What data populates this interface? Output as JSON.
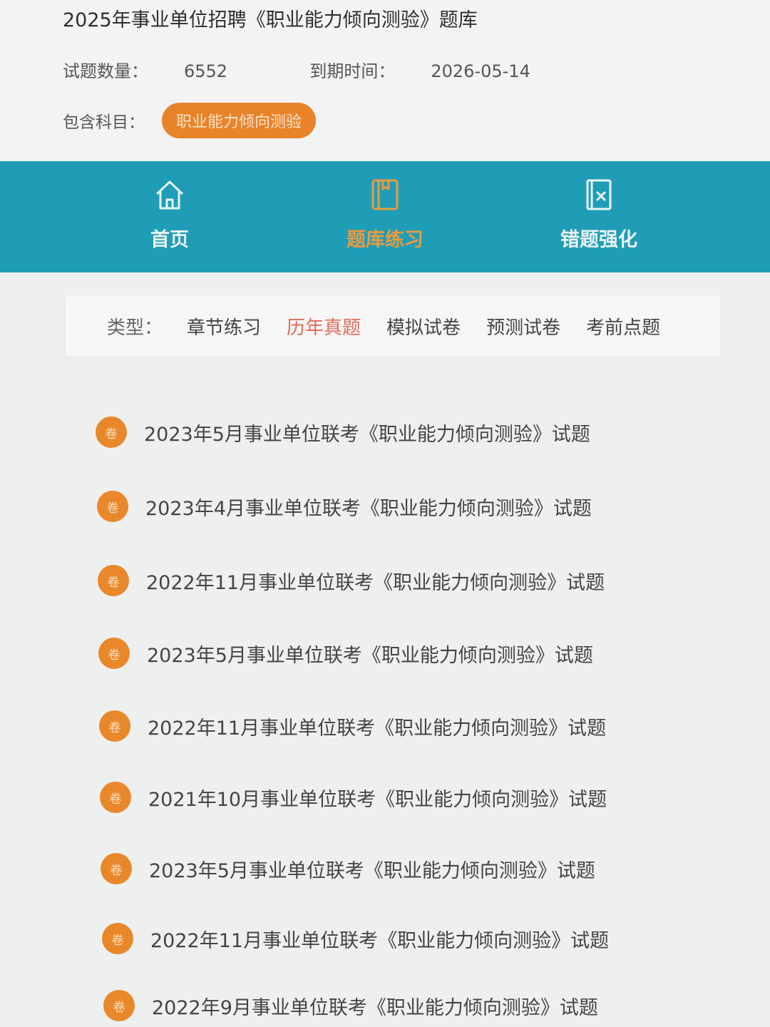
{
  "header": {
    "title": "2025年事业单位招聘《职业能力倾向测验》题库",
    "count_label": "试题数量：",
    "count_value": "6552",
    "expiry_label": "到期时间：",
    "expiry_value": "2026-05-14",
    "subjects_label": "包含科目：",
    "subject_tag": "职业能力倾向测验"
  },
  "nav": {
    "items": [
      {
        "label": "首页",
        "icon": "home-icon"
      },
      {
        "label": "题库练习",
        "icon": "book-icon"
      },
      {
        "label": "错题强化",
        "icon": "wrong-answer-icon"
      }
    ],
    "active_index": 1,
    "active_color": "#e99a3f",
    "bar_color": "#1f9db7"
  },
  "filter": {
    "label": "类型：",
    "options": [
      "章节练习",
      "历年真题",
      "模拟试卷",
      "预测试卷",
      "考前点题"
    ],
    "active_index": 1,
    "active_color": "#e36a5a"
  },
  "papers": {
    "badge": "卷",
    "items": [
      "2023年5月事业单位联考《职业能力倾向测验》试题",
      "2023年4月事业单位联考《职业能力倾向测验》试题",
      "2022年11月事业单位联考《职业能力倾向测验》试题",
      "2023年5月事业单位联考《职业能力倾向测验》试题",
      "2022年11月事业单位联考《职业能力倾向测验》试题",
      "2021年10月事业单位联考《职业能力倾向测验》试题",
      "2023年5月事业单位联考《职业能力倾向测验》试题",
      "2022年11月事业单位联考《职业能力倾向测验》试题",
      "2022年9月事业单位联考《职业能力倾向测验》试题"
    ]
  }
}
